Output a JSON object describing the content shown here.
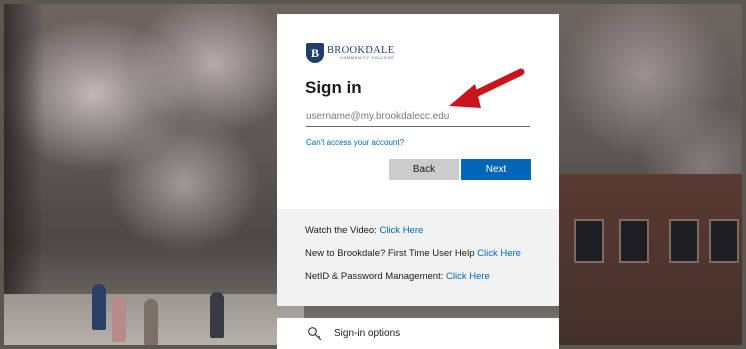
{
  "background": {
    "description_icon": "campus-photo"
  },
  "logo": {
    "mark": "B",
    "name": "BROOKDALE",
    "sub": "COMMUNITY COLLEGE"
  },
  "signin": {
    "title": "Sign in",
    "email_placeholder": "username@my.brookdalecc.edu",
    "email_value": "",
    "cant_access_label": "Can't access your account?",
    "back_label": "Back",
    "next_label": "Next"
  },
  "info": {
    "video_text": "Watch the Video: ",
    "video_link": "Click Here",
    "help_text": "New to Brookdale? First Time User Help ",
    "help_link": "Click Here",
    "netid_text": "NetID & Password Management: ",
    "netid_link": "Click Here"
  },
  "options": {
    "label": "Sign-in options",
    "icon": "key-icon"
  },
  "annotation": {
    "icon": "red-arrow-icon",
    "color": "#c8141a"
  },
  "colors": {
    "accent": "#0067b8",
    "brand": "#1f3f6b",
    "back_button": "#cccccc"
  }
}
